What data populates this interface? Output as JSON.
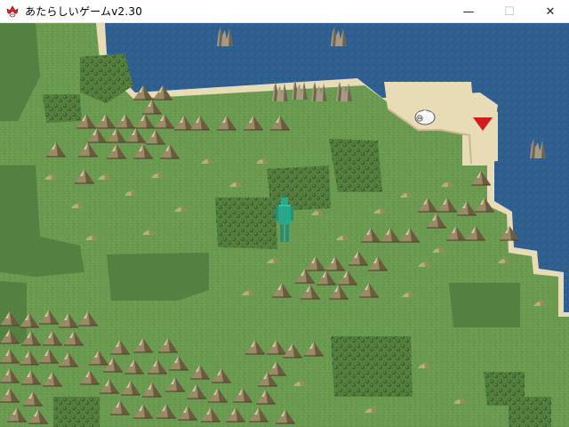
{
  "window": {
    "title": "あたらしいゲームv2.30",
    "minimize_glyph": "—",
    "maximize_glyph": "☐",
    "close_glyph": "✕"
  },
  "scene": {
    "type": "overworld-map",
    "terrain": [
      "grassland",
      "forest",
      "mountains",
      "sea",
      "sand"
    ],
    "colors": {
      "grass": "#6a9a4f",
      "grass_dark": "#4f7d3f",
      "sea": "#2f5f8e",
      "sand": "#e8dcb6",
      "mountain": "#8a7a5a",
      "player": "#2aa88c",
      "marker": "#d01c1c"
    },
    "icons": [
      "sheep-icon",
      "destination-marker-icon",
      "rock-spire-icon",
      "player-character"
    ]
  }
}
